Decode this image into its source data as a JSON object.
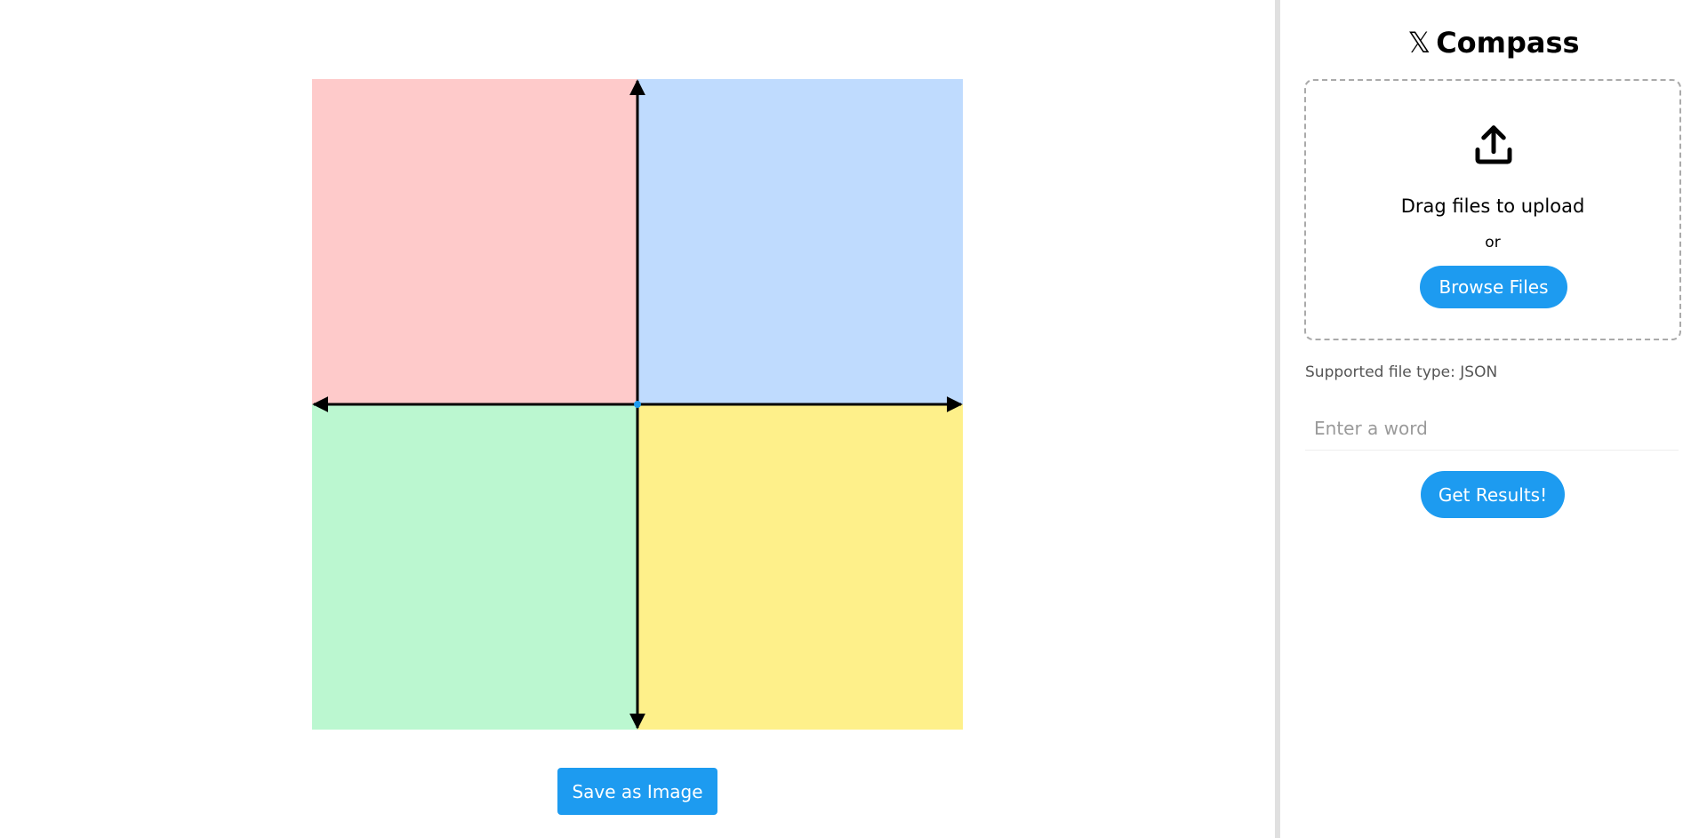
{
  "colors": {
    "accent": "#1d9bf0",
    "quadrant_top_left": "#fecaca",
    "quadrant_top_right": "#bfdbfe",
    "quadrant_bottom_left": "#bbf7d0",
    "quadrant_bottom_right": "#fef08a",
    "axis": "#000000",
    "center_dot": "#1d9bf0"
  },
  "main": {
    "save_label": "Save as Image"
  },
  "sidebar": {
    "logo_glyph": "𝕏",
    "title": "Compass",
    "upload_icon": "upload-icon",
    "drag_label": "Drag files to upload",
    "or_label": "or",
    "browse_label": "Browse Files",
    "supported_label": "Supported file type: JSON",
    "word_input": {
      "value": "",
      "placeholder": "Enter a word"
    },
    "get_results_label": "Get Results!"
  }
}
